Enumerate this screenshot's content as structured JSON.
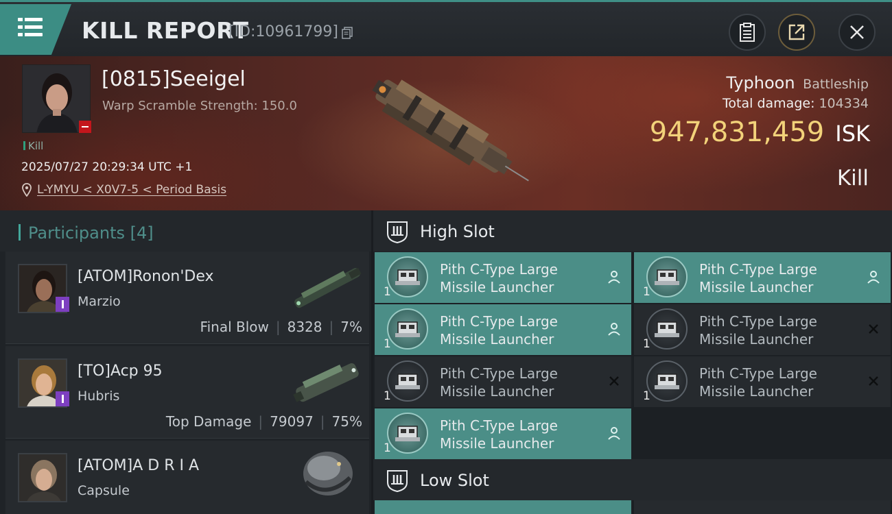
{
  "header": {
    "title": "KILL REPORT",
    "report_id": "[ID:10961799]"
  },
  "victim": {
    "name": "[0815]Seeigel",
    "scramble": "Warp Scramble Strength: 150.0",
    "kill_tag": "Kill",
    "datetime": "2025/07/27 20:29:34 UTC +1",
    "location": "L-YMYU < X0V7-5 < Period Basis",
    "ship_name": "Typhoon",
    "ship_class": "Battleship",
    "total_damage_label": "Total damage:",
    "total_damage": "104334",
    "isk_value": "947,831,459",
    "isk_unit": "ISK",
    "result": "Kill"
  },
  "participants": {
    "title": "Participants",
    "count": "[4]",
    "rows": [
      {
        "name": "[ATOM]Ronon'Dex",
        "ship": "Marzio",
        "tag": "Final Blow",
        "damage": "8328",
        "percent": "7%"
      },
      {
        "name": "[TO]Acp 95",
        "ship": "Hubris",
        "tag": "Top Damage",
        "damage": "79097",
        "percent": "75%"
      },
      {
        "name": "[ATOM]A D R I A",
        "ship": "Capsule"
      }
    ]
  },
  "fittings": {
    "high_slot_title": "High Slot",
    "low_slot_title": "Low Slot",
    "modules": [
      {
        "name_line1": "Pith C-Type Large",
        "name_line2": "Missile Launcher",
        "qty": "1",
        "state": "destroyed"
      },
      {
        "name_line1": "Pith C-Type Large",
        "name_line2": "Missile Launcher",
        "qty": "1",
        "state": "destroyed"
      },
      {
        "name_line1": "Pith C-Type Large",
        "name_line2": "Missile Launcher",
        "qty": "1",
        "state": "destroyed"
      },
      {
        "name_line1": "Pith C-Type Large",
        "name_line2": "Missile Launcher",
        "qty": "1",
        "state": "dropped"
      },
      {
        "name_line1": "Pith C-Type Large",
        "name_line2": "Missile Launcher",
        "qty": "1",
        "state": "dropped"
      },
      {
        "name_line1": "Pith C-Type Large",
        "name_line2": "Missile Launcher",
        "qty": "1",
        "state": "dropped"
      },
      {
        "name_line1": "Pith C-Type Large",
        "name_line2": "Missile Launcher",
        "qty": "1",
        "state": "destroyed"
      }
    ]
  },
  "colors": {
    "accent_teal": "#3c8d84",
    "isk_gold": "#f2d27a",
    "destroyed_module": "#4b8e87",
    "alert_red": "#c4161c",
    "corp_purple": "#7d3fc0"
  },
  "icons": [
    "menu-icon",
    "copy-icon",
    "clipboard-icon",
    "share-icon",
    "close-icon",
    "location-pin-icon",
    "shield-slot-icon",
    "person-icon",
    "x-mark-icon"
  ]
}
